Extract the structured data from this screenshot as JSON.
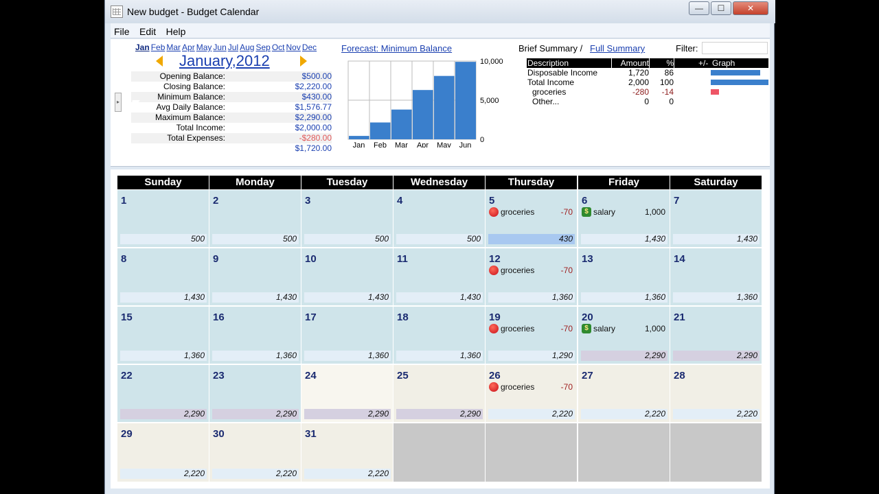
{
  "window": {
    "title": "New budget - Budget Calendar",
    "minimize": "—",
    "maximize": "☐",
    "close": "✕"
  },
  "menu": [
    "File",
    "Edit",
    "Help"
  ],
  "months": [
    "Jan",
    "Feb",
    "Mar",
    "Apr",
    "May",
    "Jun",
    "Jul",
    "Aug",
    "Sep",
    "Oct",
    "Nov",
    "Dec"
  ],
  "active_month": "Jan",
  "current_month": "January,2012",
  "stats": [
    {
      "label": "Opening Balance:",
      "value": "$500.00"
    },
    {
      "label": "Closing Balance:",
      "value": "$2,220.00"
    },
    {
      "label": "Minimum Balance:",
      "value": "$430.00"
    },
    {
      "label": "Avg Daily Balance:",
      "value": "$1,576.77"
    },
    {
      "label": "Maximum Balance:",
      "value": "$2,290.00"
    },
    {
      "label": "Total Income:",
      "value": "$2,000.00"
    },
    {
      "label": "Total Expenses:",
      "value": "-$280.00",
      "negative": true
    },
    {
      "label": "",
      "value": "$1,720.00"
    }
  ],
  "forecast_link": "Forecast: Minimum Balance",
  "chart_data": {
    "type": "bar",
    "categories": [
      "Jan",
      "Feb",
      "Mar",
      "Apr",
      "May",
      "Jun"
    ],
    "values": [
      430,
      2150,
      3800,
      6300,
      8100,
      9900
    ],
    "ylim": [
      0,
      10000
    ],
    "yticks": [
      {
        "value": 10000,
        "label": "10,000"
      },
      {
        "value": 5000,
        "label": "5,000"
      },
      {
        "value": 0,
        "label": "0"
      }
    ],
    "bar_color": "#3a7fcc"
  },
  "summary": {
    "brief_label": "Brief Summary /",
    "full_link": "Full Summary",
    "filter_label": "Filter:",
    "filter_value": "",
    "headers": {
      "description": "Description",
      "amount": "Amount",
      "pct": "%",
      "pm": "+/-",
      "graph": "Graph"
    },
    "rows": [
      {
        "description": "Disposable Income",
        "amount": "1,720",
        "pct": "86",
        "bar_pct": 86,
        "bar_color": "#3a7fcc"
      },
      {
        "description": "Total Income",
        "amount": "2,000",
        "pct": "100",
        "bar_pct": 100,
        "bar_color": "#3a7fcc"
      },
      {
        "description": "groceries",
        "amount": "-280",
        "pct": "-14",
        "bar_pct": 14,
        "bar_color": "#ee5566",
        "negative": true,
        "indent": true
      },
      {
        "description": "Other...",
        "amount": "0",
        "pct": "0",
        "bar_pct": 0,
        "bar_color": "#3a7fcc",
        "indent": true,
        "gray": true
      }
    ]
  },
  "calendar": {
    "days": [
      "Sunday",
      "Monday",
      "Tuesday",
      "Wednesday",
      "Thursday",
      "Friday",
      "Saturday"
    ],
    "weeks": [
      [
        {
          "day": "1",
          "balance": "500",
          "shade": "blue"
        },
        {
          "day": "2",
          "balance": "500",
          "shade": "blue"
        },
        {
          "day": "3",
          "balance": "500",
          "shade": "blue"
        },
        {
          "day": "4",
          "balance": "500",
          "shade": "blue"
        },
        {
          "day": "5",
          "balance": "430",
          "shade": "blue",
          "balance_kind": "min",
          "event": {
            "icon": "apple",
            "name": "groceries",
            "amount": "-70"
          }
        },
        {
          "day": "6",
          "balance": "1,430",
          "shade": "blue",
          "event": {
            "icon": "money",
            "name": "salary",
            "amount": "1,000"
          }
        },
        {
          "day": "7",
          "balance": "1,430",
          "shade": "blue"
        }
      ],
      [
        {
          "day": "8",
          "balance": "1,430",
          "shade": "blue"
        },
        {
          "day": "9",
          "balance": "1,430",
          "shade": "blue"
        },
        {
          "day": "10",
          "balance": "1,430",
          "shade": "blue"
        },
        {
          "day": "11",
          "balance": "1,430",
          "shade": "blue"
        },
        {
          "day": "12",
          "balance": "1,360",
          "shade": "blue",
          "event": {
            "icon": "apple",
            "name": "groceries",
            "amount": "-70"
          }
        },
        {
          "day": "13",
          "balance": "1,360",
          "shade": "blue"
        },
        {
          "day": "14",
          "balance": "1,360",
          "shade": "blue"
        }
      ],
      [
        {
          "day": "15",
          "balance": "1,360",
          "shade": "blue"
        },
        {
          "day": "16",
          "balance": "1,360",
          "shade": "blue"
        },
        {
          "day": "17",
          "balance": "1,360",
          "shade": "blue"
        },
        {
          "day": "18",
          "balance": "1,360",
          "shade": "blue"
        },
        {
          "day": "19",
          "balance": "1,290",
          "shade": "blue",
          "event": {
            "icon": "apple",
            "name": "groceries",
            "amount": "-70"
          }
        },
        {
          "day": "20",
          "balance": "2,290",
          "shade": "blue",
          "balance_kind": "max",
          "event": {
            "icon": "money",
            "name": "salary",
            "amount": "1,000"
          }
        },
        {
          "day": "21",
          "balance": "2,290",
          "shade": "blue",
          "balance_kind": "max"
        }
      ],
      [
        {
          "day": "22",
          "balance": "2,290",
          "shade": "blue",
          "balance_kind": "max"
        },
        {
          "day": "23",
          "balance": "2,290",
          "shade": "blue",
          "balance_kind": "max"
        },
        {
          "day": "24",
          "balance": "2,290",
          "shade": "cream",
          "balance_kind": "max"
        },
        {
          "day": "25",
          "balance": "2,290",
          "shade": "cream2",
          "balance_kind": "max"
        },
        {
          "day": "26",
          "balance": "2,220",
          "shade": "cream2",
          "event": {
            "icon": "apple",
            "name": "groceries",
            "amount": "-70"
          }
        },
        {
          "day": "27",
          "balance": "2,220",
          "shade": "cream2"
        },
        {
          "day": "28",
          "balance": "2,220",
          "shade": "cream2"
        }
      ],
      [
        {
          "day": "29",
          "balance": "2,220",
          "shade": "cream2"
        },
        {
          "day": "30",
          "balance": "2,220",
          "shade": "cream2"
        },
        {
          "day": "31",
          "balance": "2,220",
          "shade": "cream2"
        },
        {
          "day": "",
          "balance": "",
          "shade": "gray"
        },
        {
          "day": "",
          "balance": "",
          "shade": "gray"
        },
        {
          "day": "",
          "balance": "",
          "shade": "gray"
        },
        {
          "day": "",
          "balance": "",
          "shade": "gray"
        }
      ]
    ]
  }
}
